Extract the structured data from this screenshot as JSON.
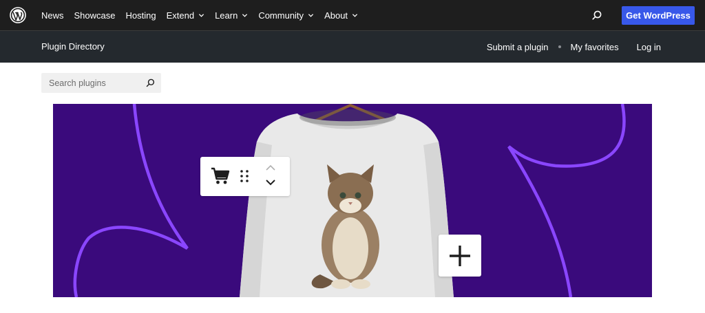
{
  "global_nav": {
    "logo_icon": "wordpress-logo-icon",
    "items": [
      {
        "label": "News",
        "has_dropdown": false
      },
      {
        "label": "Showcase",
        "has_dropdown": false
      },
      {
        "label": "Hosting",
        "has_dropdown": false
      },
      {
        "label": "Extend",
        "has_dropdown": true
      },
      {
        "label": "Learn",
        "has_dropdown": true
      },
      {
        "label": "Community",
        "has_dropdown": true
      },
      {
        "label": "About",
        "has_dropdown": true
      }
    ],
    "search_icon": "search-icon",
    "cta_label": "Get WordPress",
    "background": "#1e1e1e",
    "cta_color": "#3858e9"
  },
  "local_nav": {
    "title": "Plugin Directory",
    "links": {
      "submit": "Submit a plugin",
      "favorites": "My favorites",
      "login": "Log in"
    }
  },
  "search": {
    "placeholder": "Search plugins",
    "value": "",
    "icon": "search-icon"
  },
  "banner": {
    "background": "#3a0a7c",
    "accent": "#7b3ff2",
    "toolbar_icons": [
      "cart-icon",
      "drag-handle-icon",
      "chevron-up-icon",
      "chevron-down-icon"
    ],
    "add_icon": "plus-icon",
    "illustration": "white sweatshirt on hanger with kitten print"
  }
}
